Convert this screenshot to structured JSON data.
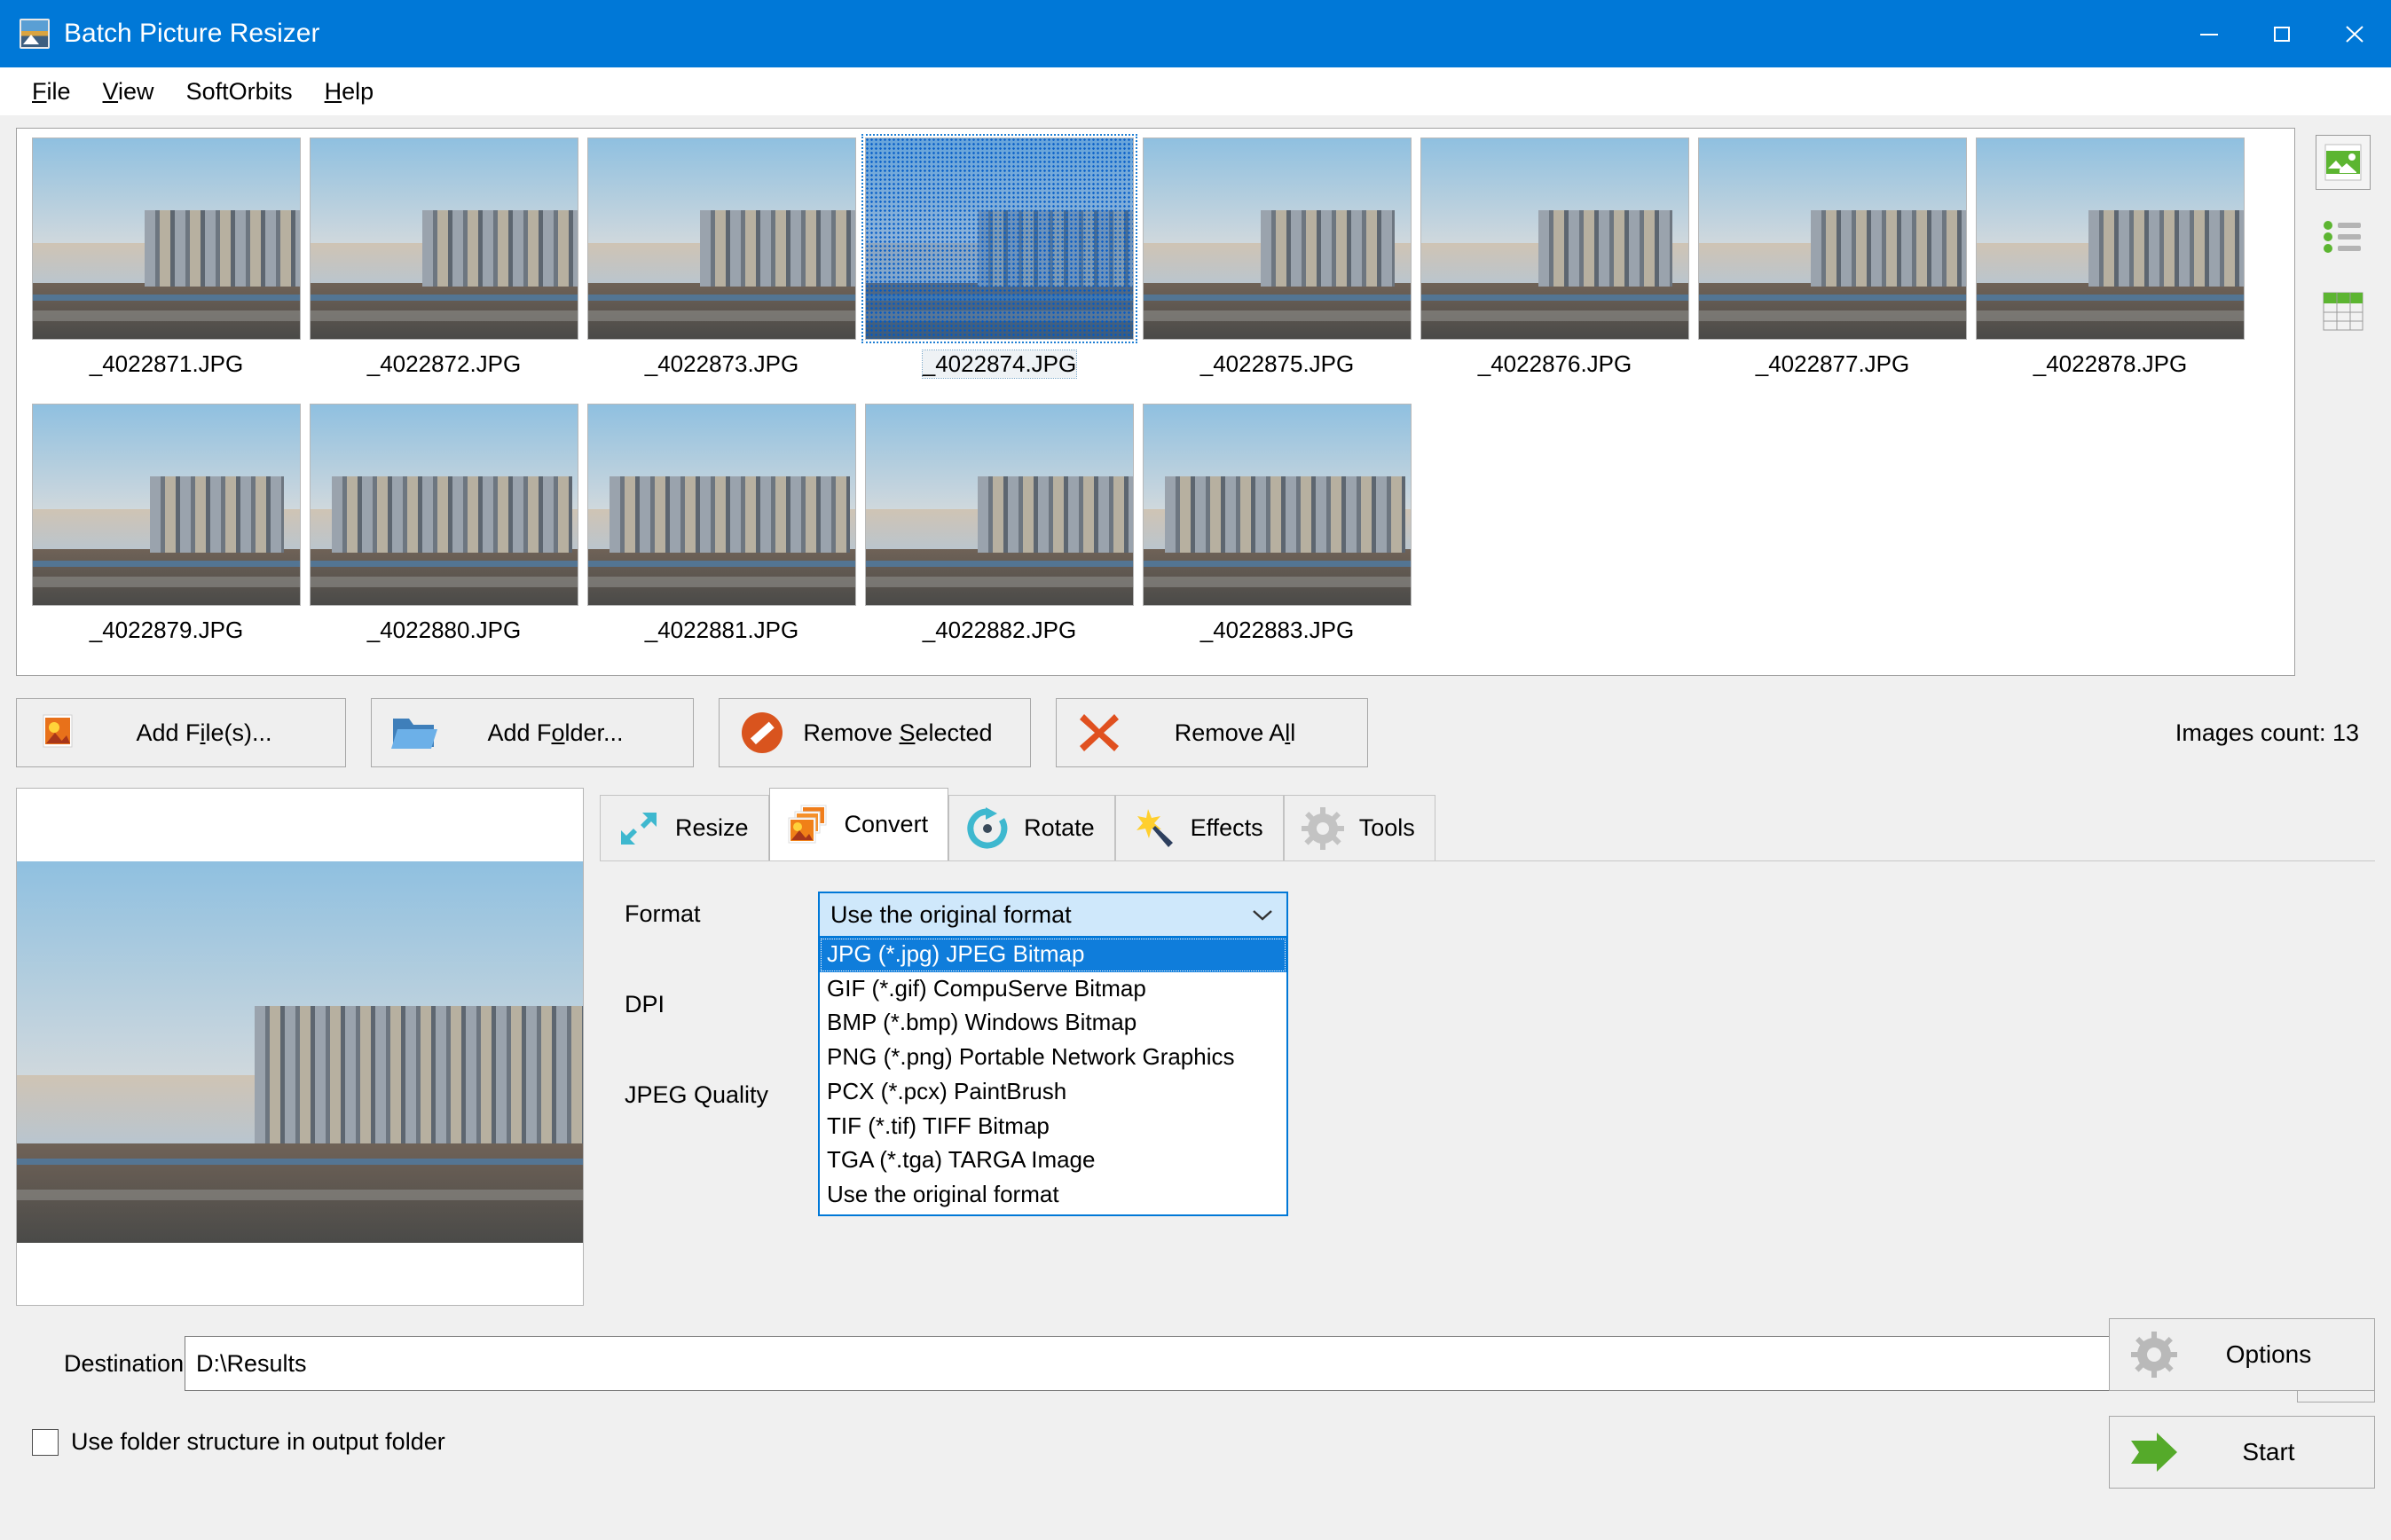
{
  "window": {
    "title": "Batch Picture Resizer",
    "icon": "app-picture-icon",
    "minimize": "minimize-icon",
    "maximize": "maximize-icon",
    "close": "close-icon"
  },
  "menubar": {
    "items": [
      {
        "label": "File",
        "accel": "F"
      },
      {
        "label": "View",
        "accel": "V"
      },
      {
        "label": "SoftOrbits",
        "accel": ""
      },
      {
        "label": "Help",
        "accel": "H"
      }
    ]
  },
  "thumbnails": {
    "items": [
      {
        "name": "_4022871.JPG",
        "selected": false
      },
      {
        "name": "_4022872.JPG",
        "selected": false
      },
      {
        "name": "_4022873.JPG",
        "selected": false
      },
      {
        "name": "_4022874.JPG",
        "selected": true
      },
      {
        "name": "_4022875.JPG",
        "selected": false
      },
      {
        "name": "_4022876.JPG",
        "selected": false
      },
      {
        "name": "_4022877.JPG",
        "selected": false
      },
      {
        "name": "_4022878.JPG",
        "selected": false
      },
      {
        "name": "_4022879.JPG",
        "selected": false
      },
      {
        "name": "_4022880.JPG",
        "selected": false
      },
      {
        "name": "_4022881.JPG",
        "selected": false
      },
      {
        "name": "_4022882.JPG",
        "selected": false
      },
      {
        "name": "_4022883.JPG",
        "selected": false
      }
    ]
  },
  "view_modes": {
    "thumbnail": "thumbnail-view-icon",
    "list": "list-view-icon",
    "table": "table-view-icon",
    "accent": "#5cb531"
  },
  "actions": {
    "add_files": {
      "label": "Add File(s)...",
      "accel": "l",
      "icon": "picture-icon"
    },
    "add_folder": {
      "label": "Add Folder...",
      "accel": "o",
      "icon": "folder-icon"
    },
    "remove_selected": {
      "label": "Remove Selected",
      "accel": "S",
      "icon": "no-entry-icon"
    },
    "remove_all": {
      "label": "Remove All",
      "accel": "A",
      "icon": "red-x-icon"
    },
    "images_count": "Images count: 13"
  },
  "tabs": [
    {
      "label": "Resize",
      "icon": "resize-arrow-icon",
      "active": false
    },
    {
      "label": "Convert",
      "icon": "convert-images-icon",
      "active": true
    },
    {
      "label": "Rotate",
      "icon": "rotate-circle-icon",
      "active": false
    },
    {
      "label": "Effects",
      "icon": "magic-wand-icon",
      "active": false
    },
    {
      "label": "Tools",
      "icon": "gear-icon",
      "active": false
    }
  ],
  "convert_panel": {
    "format_label": "Format",
    "dpi_label": "DPI",
    "jpeg_quality_label": "JPEG Quality",
    "format_value": "Use the original format",
    "format_dropdown_open": true,
    "format_options": [
      {
        "label": "JPG (*.jpg) JPEG Bitmap",
        "highlighted": true
      },
      {
        "label": "GIF (*.gif) CompuServe Bitmap",
        "highlighted": false
      },
      {
        "label": "BMP (*.bmp) Windows Bitmap",
        "highlighted": false
      },
      {
        "label": "PNG (*.png) Portable Network Graphics",
        "highlighted": false
      },
      {
        "label": "PCX (*.pcx) PaintBrush",
        "highlighted": false
      },
      {
        "label": "TIF (*.tif) TIFF Bitmap",
        "highlighted": false
      },
      {
        "label": "TGA (*.tga) TARGA Image",
        "highlighted": false
      },
      {
        "label": "Use the original format",
        "highlighted": false
      }
    ]
  },
  "bottom": {
    "destination_label": "Destination",
    "destination_value": "D:\\Results",
    "browse_icon": "open-folder-icon",
    "use_folder_structure_label": "Use folder structure in output folder",
    "use_folder_structure_checked": false,
    "options_label": "Options",
    "options_icon": "gear-icon",
    "start_label": "Start",
    "start_icon": "green-arrow-icon"
  },
  "colors": {
    "titlebar": "#0078d7",
    "accent_blue": "#0078d7",
    "highlight": "#0f7ddb",
    "green": "#5cb531",
    "orange": "#e8751a",
    "cyan": "#3eb8cf"
  }
}
